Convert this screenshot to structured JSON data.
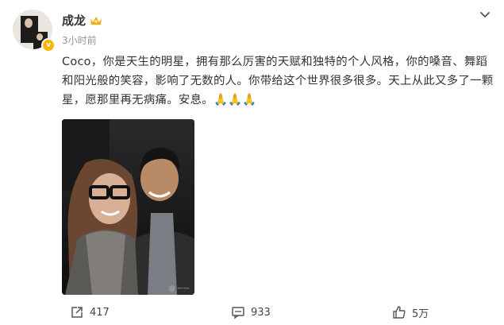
{
  "post": {
    "author": "成龙",
    "time": "3小时前",
    "content": "Coco，你是天生的明星，拥有那么厉害的天赋和独特的个人风格，你的嗓音、舞蹈和阳光般的笑容，影响了无数的人。你带给这个世界很多很多。天上从此又多了一颗星，愿那里再无病痛。安息。🙏🙏🙏",
    "verified_badge": "v",
    "watermark": "@ ——"
  },
  "icons": {
    "menu": "chevron-down-icon",
    "crown": "crown-icon",
    "share": "share-icon",
    "comment": "comment-icon",
    "like": "thumbs-up-icon"
  },
  "actions": {
    "share_count": "417",
    "comment_count": "933",
    "like_count": "5万"
  },
  "colors": {
    "crown": "#f7a90a",
    "verified": "#f7b500",
    "text": "#333333",
    "meta": "#939393"
  }
}
